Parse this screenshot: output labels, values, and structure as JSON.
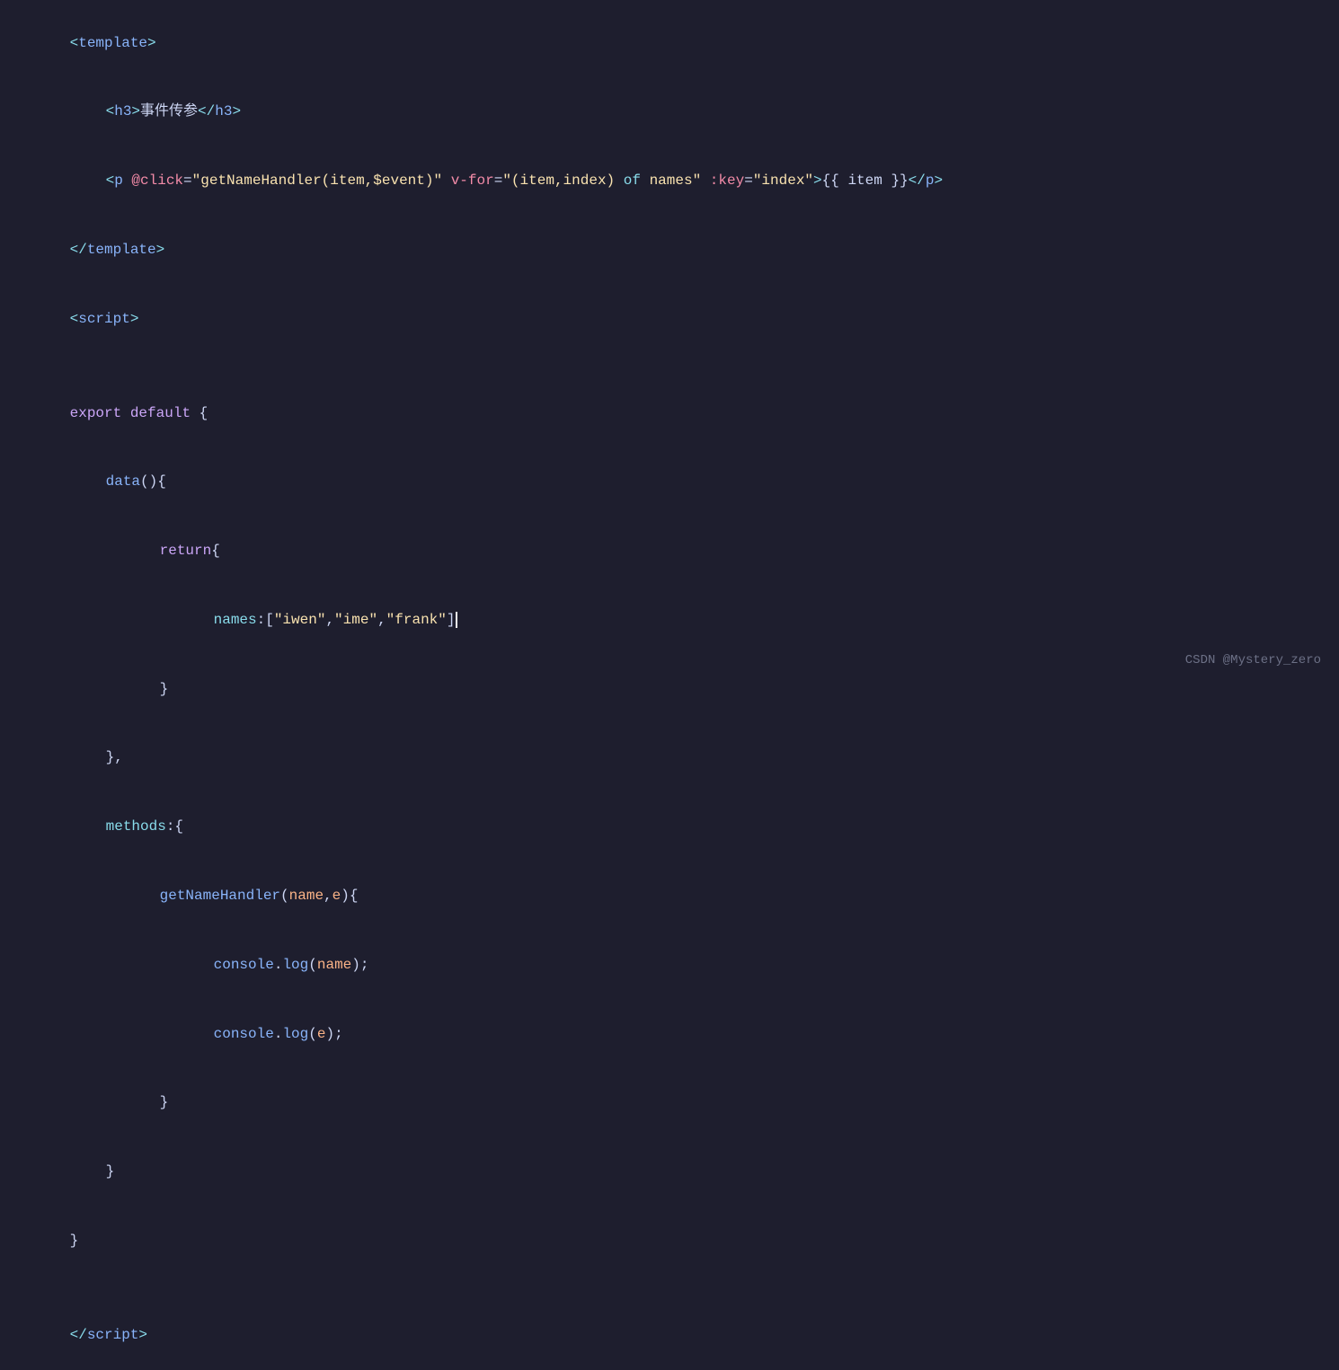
{
  "editor": {
    "background": "#1e1e2e",
    "watermark": "CSDN @Mystery_zero"
  },
  "lines": [
    {
      "id": "line1",
      "indent": 0,
      "content": "template_open"
    },
    {
      "id": "line2",
      "indent": 1,
      "content": "h3_tag"
    },
    {
      "id": "line3",
      "indent": 1,
      "content": "p_tag"
    },
    {
      "id": "line4",
      "indent": 0,
      "content": "template_close"
    },
    {
      "id": "line5",
      "indent": 0,
      "content": "script_open"
    },
    {
      "id": "line6",
      "indent": 0,
      "content": "empty"
    },
    {
      "id": "line7",
      "indent": 0,
      "content": "export_default"
    },
    {
      "id": "line8",
      "indent": 1,
      "content": "data_func"
    },
    {
      "id": "line9",
      "indent": 2,
      "content": "return_open"
    },
    {
      "id": "line10",
      "indent": 3,
      "content": "names_array"
    },
    {
      "id": "line11",
      "indent": 2,
      "content": "brace_close"
    },
    {
      "id": "line12",
      "indent": 1,
      "content": "comma_brace"
    },
    {
      "id": "line13",
      "indent": 1,
      "content": "methods_open"
    },
    {
      "id": "line14",
      "indent": 2,
      "content": "get_name_handler"
    },
    {
      "id": "line15",
      "indent": 3,
      "content": "console_name"
    },
    {
      "id": "line16",
      "indent": 3,
      "content": "console_e"
    },
    {
      "id": "line17",
      "indent": 2,
      "content": "brace_close2"
    },
    {
      "id": "line18",
      "indent": 1,
      "content": "brace_close3"
    },
    {
      "id": "line19",
      "indent": 0,
      "content": "brace_close4"
    },
    {
      "id": "line20",
      "indent": 0,
      "content": "empty2"
    },
    {
      "id": "line21",
      "indent": 0,
      "content": "script_close"
    }
  ]
}
